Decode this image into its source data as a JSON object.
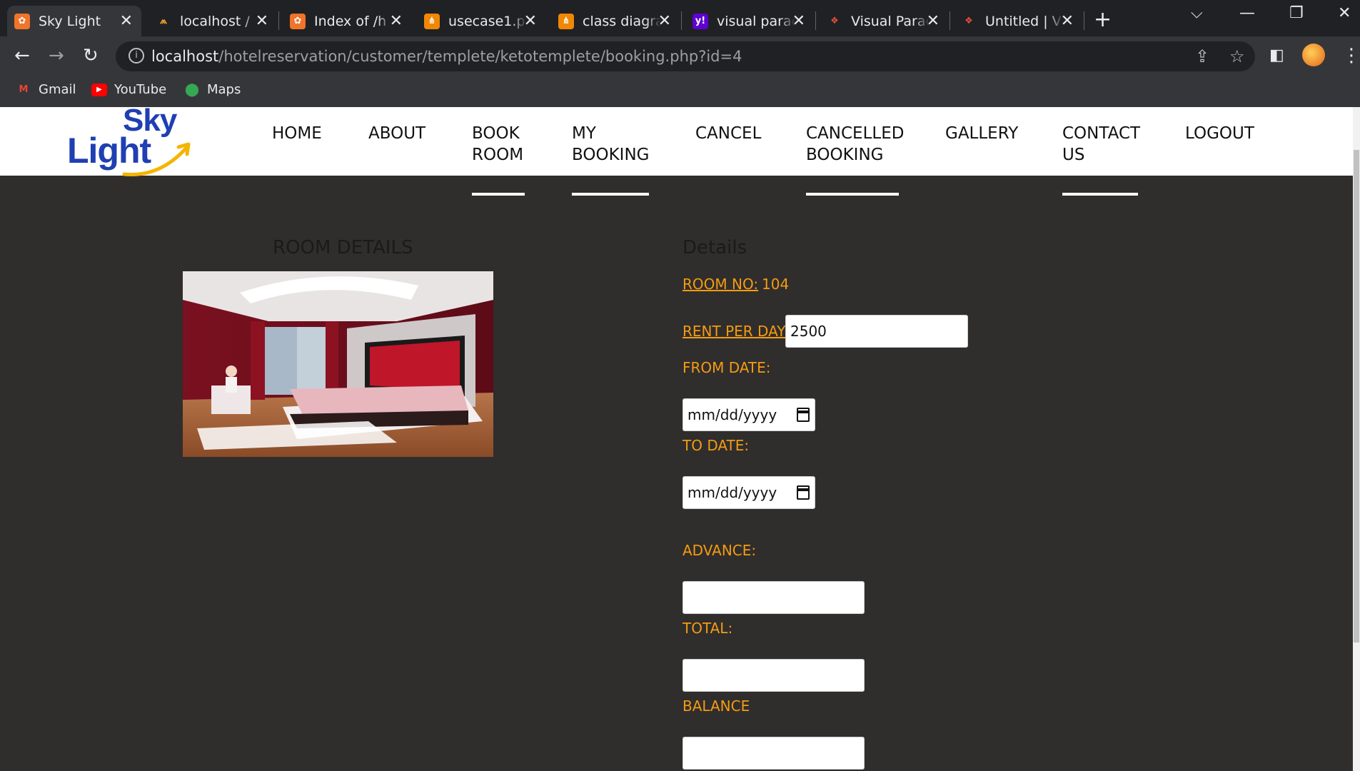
{
  "browser": {
    "tabs": [
      {
        "label": "Sky Light",
        "icon": "xampp-icon",
        "active": true
      },
      {
        "label": "localhost / ",
        "icon": "phpmyadmin-icon",
        "active": false
      },
      {
        "label": "Index of /h",
        "icon": "xampp-icon",
        "active": false
      },
      {
        "label": "usecase1.p",
        "icon": "draw-icon",
        "active": false
      },
      {
        "label": "class diagra",
        "icon": "draw-icon",
        "active": false
      },
      {
        "label": "visual parac",
        "icon": "yahoo-icon",
        "active": false
      },
      {
        "label": "Visual Parac",
        "icon": "visual-paradigm-icon",
        "active": false
      },
      {
        "label": "Untitled | V",
        "icon": "visual-paradigm-icon",
        "active": false
      }
    ],
    "url_host": "localhost",
    "url_path": "/hotelreservation/customer/templete/ketotemplete/booking.php?id=4",
    "bookmarks": [
      {
        "label": "Gmail",
        "icon": "gmail-icon"
      },
      {
        "label": "YouTube",
        "icon": "youtube-icon"
      },
      {
        "label": "Maps",
        "icon": "maps-icon"
      }
    ]
  },
  "site": {
    "logo_line1": "Sky",
    "logo_line2": "Light",
    "nav": [
      {
        "line1": "HOME",
        "line2": ""
      },
      {
        "line1": "ABOUT",
        "line2": ""
      },
      {
        "line1": "BOOK",
        "line2": "ROOM"
      },
      {
        "line1": "MY",
        "line2": "BOOKING"
      },
      {
        "line1": "CANCEL",
        "line2": ""
      },
      {
        "line1": "CANCELLED",
        "line2": "BOOKING"
      },
      {
        "line1": "GALLERY",
        "line2": ""
      },
      {
        "line1": "CONTACT",
        "line2": "US"
      },
      {
        "line1": "LOGOUT",
        "line2": ""
      }
    ]
  },
  "room": {
    "heading": "ROOM DETAILS"
  },
  "details": {
    "heading": "Details",
    "room_no_label": "ROOM NO:",
    "room_no_value": "104",
    "rent_label": "RENT PER DAY:",
    "rent_value": "2500",
    "from_label": "FROM DATE:",
    "from_placeholder": "mm/dd/yyyy",
    "to_label": "TO DATE:",
    "to_placeholder": "mm/dd/yyyy",
    "advance_label": "ADVANCE:",
    "total_label": "TOTAL:",
    "balance_label": "BALANCE"
  },
  "colors": {
    "accent": "#f39c12",
    "page_bg": "#302d2d",
    "logo_blue": "#1f3fb2"
  }
}
